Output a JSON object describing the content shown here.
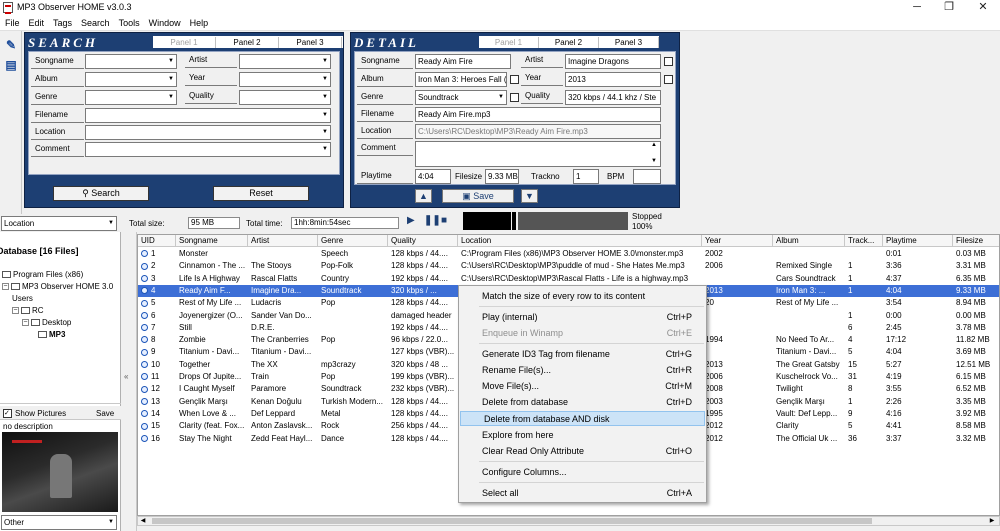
{
  "window": {
    "title": "MP3 Observer HOME v3.0.3",
    "min": "─",
    "max": "❐",
    "close": "✕"
  },
  "menu": [
    "File",
    "Edit",
    "Tags",
    "Search",
    "Tools",
    "Window",
    "Help"
  ],
  "search_panel": {
    "header": "SEARCH",
    "tabs": [
      "Panel 1",
      "Panel 2",
      "Panel 3"
    ],
    "labels": {
      "songname": "Songname",
      "artist": "Artist",
      "album": "Album",
      "year": "Year",
      "genre": "Genre",
      "quality": "Quality",
      "filename": "Filename",
      "location": "Location",
      "comment": "Comment"
    },
    "search_button": "Search",
    "reset_button": "Reset"
  },
  "detail_panel": {
    "header": "DETAIL",
    "tabs": [
      "Panel 1",
      "Panel 2",
      "Panel 3"
    ],
    "labels": {
      "songname": "Songname",
      "artist": "Artist",
      "album": "Album",
      "year": "Year",
      "genre": "Genre",
      "quality": "Quality",
      "filename": "Filename",
      "location": "Location",
      "comment": "Comment",
      "playtime": "Playtime",
      "filesize": "Filesize",
      "trackno": "Trackno",
      "bpm": "BPM"
    },
    "values": {
      "songname": "Ready Aim Fire",
      "artist": "Imagine Dragons",
      "album": "Iron Man 3: Heroes Fall (M",
      "year": "2013",
      "genre": "Soundtrack",
      "quality": "320 kbps / 44.1 khz / Ste",
      "filename": "Ready Aim Fire.mp3",
      "location": "C:\\Users\\RC\\Desktop\\MP3\\Ready Aim Fire.mp3",
      "comment": "",
      "playtime": "4:04",
      "filesize": "9.33 MB",
      "trackno": "1",
      "bpm": ""
    },
    "save_button": "Save"
  },
  "status": {
    "location_select": "Location",
    "total_size_label": "Total size:",
    "total_size": "95 MB",
    "total_time_label": "Total time:",
    "total_time": "1hh:8min:54sec",
    "player_state": "Stopped",
    "volume": "100%"
  },
  "tree": {
    "root": "Database [16 Files]",
    "items": [
      "Program Files (x86)",
      "MP3 Observer HOME 3.0",
      "Users",
      "RC",
      "Desktop",
      "MP3"
    ]
  },
  "pictures": {
    "show_label": "Show Pictures",
    "save_label": "Save",
    "description": "no description",
    "type_select": "Other"
  },
  "grid": {
    "columns": [
      "UID",
      "Songname",
      "Artist",
      "Genre",
      "Quality",
      "Location",
      "Year",
      "Album",
      "Track...",
      "Playtime",
      "Filesize"
    ],
    "rows": [
      [
        "1",
        "Monster",
        "",
        "Speech",
        "128 kbps / 44....",
        "C:\\Program Files (x86)\\MP3 Observer HOME 3.0\\monster.mp3",
        "2002",
        "",
        "",
        "0:01",
        "0.03 MB"
      ],
      [
        "2",
        "Cinnamon - The ...",
        "The Stooys",
        "Pop-Folk",
        "128 kbps / 44....",
        "C:\\Users\\RC\\Desktop\\MP3\\puddle of mud - She Hates Me.mp3",
        "2006",
        "Remixed Single",
        "1",
        "3:36",
        "3.31 MB"
      ],
      [
        "3",
        "Life Is A Highway",
        "Rascal Flatts",
        "Country",
        "192 kbps / 44....",
        "C:\\Users\\RC\\Desktop\\MP3\\Rascal Flatts - Life is a highway.mp3",
        "",
        "Cars Soundtrack",
        "1",
        "4:37",
        "6.35 MB"
      ],
      [
        "4",
        "Ready Aim F...",
        "Imagine Dra...",
        "Soundtrack",
        "320 kbps / ...",
        "",
        "2013",
        "Iron Man 3: ...",
        "1",
        "4:04",
        "9.33 MB"
      ],
      [
        "5",
        "Rest of My Life ...",
        "Ludacris",
        "Pop",
        "128 kbps / 44....",
        "",
        "20",
        "Rest of My Life ...",
        "",
        "3:54",
        "8.94 MB"
      ],
      [
        "6",
        "Joyenergizer (O...",
        "Sander Van Do...",
        "",
        "damaged header",
        "",
        "",
        "",
        "1",
        "0:00",
        "0.00 MB"
      ],
      [
        "7",
        "Still",
        "D.R.E.",
        "",
        "192 kbps / 44....",
        "",
        "",
        "",
        "6",
        "2:45",
        "3.78 MB"
      ],
      [
        "8",
        "Zombie",
        "The Cranberries",
        "Pop",
        "96 kbps / 22.0...",
        "",
        "1994",
        "No Need To Ar...",
        "4",
        "17:12",
        "11.82 MB"
      ],
      [
        "9",
        "Titanium - Davi...",
        "Titanium - Davi...",
        "",
        "127 kbps (VBR)...",
        "",
        "",
        "Titanium - Davi...",
        "5",
        "4:04",
        "3.69 MB"
      ],
      [
        "10",
        "Together",
        "The XX",
        "mp3crazy",
        "320 kbps / 48 ...",
        "",
        "2013",
        "The Great Gatsby",
        "15",
        "5:27",
        "12.51 MB"
      ],
      [
        "11",
        "Drops Of Jupite...",
        "Train",
        "Pop",
        "199 kbps (VBR)...",
        "",
        "2006",
        "Kuschelrock Vo...",
        "31",
        "4:19",
        "6.15 MB"
      ],
      [
        "12",
        "I Caught Myself",
        "Paramore",
        "Soundtrack",
        "232 kbps (VBR)...",
        "",
        "2008",
        "Twilight",
        "8",
        "3:55",
        "6.52 MB"
      ],
      [
        "13",
        "Gençlik Marşı",
        "Kenan Doğulu",
        "Turkish Modern...",
        "128 kbps / 44....",
        "",
        "2003",
        "Gençlik Marşı",
        "1",
        "2:26",
        "3.35 MB"
      ],
      [
        "14",
        "When Love & ...",
        "Def Leppard",
        "Metal",
        "128 kbps / 44....",
        "",
        "1995",
        "Vault: Def Lepp...",
        "9",
        "4:16",
        "3.92 MB"
      ],
      [
        "15",
        "Clarity (feat. Fox...",
        "Anton Zaslavsk...",
        "Rock",
        "256 kbps / 44....",
        "",
        "2012",
        "Clarity",
        "5",
        "4:41",
        "8.58 MB"
      ],
      [
        "16",
        "Stay The Night",
        "Zedd Feat Hayl...",
        "Dance",
        "128 kbps / 44....",
        "",
        "2012",
        "The Official Uk ...",
        "36",
        "3:37",
        "3.32 MB"
      ]
    ]
  },
  "context_menu": {
    "items": [
      {
        "label": "Match the size of every row to its content",
        "shortcut": ""
      },
      {
        "label": "Play (internal)",
        "shortcut": "Ctrl+P"
      },
      {
        "label": "Enqueue in Winamp",
        "shortcut": "Ctrl+E"
      },
      {
        "label": "Generate ID3 Tag from filename",
        "shortcut": "Ctrl+G"
      },
      {
        "label": "Rename File(s)...",
        "shortcut": "Ctrl+R"
      },
      {
        "label": "Move File(s)...",
        "shortcut": "Ctrl+M"
      },
      {
        "label": "Delete from database",
        "shortcut": "Ctrl+D"
      },
      {
        "label": "Delete from database AND disk",
        "shortcut": ""
      },
      {
        "label": "Explore from here",
        "shortcut": ""
      },
      {
        "label": "Clear Read Only Attribute",
        "shortcut": "Ctrl+O"
      },
      {
        "label": "Configure Columns...",
        "shortcut": ""
      },
      {
        "label": "Select all",
        "shortcut": "Ctrl+A"
      }
    ]
  }
}
